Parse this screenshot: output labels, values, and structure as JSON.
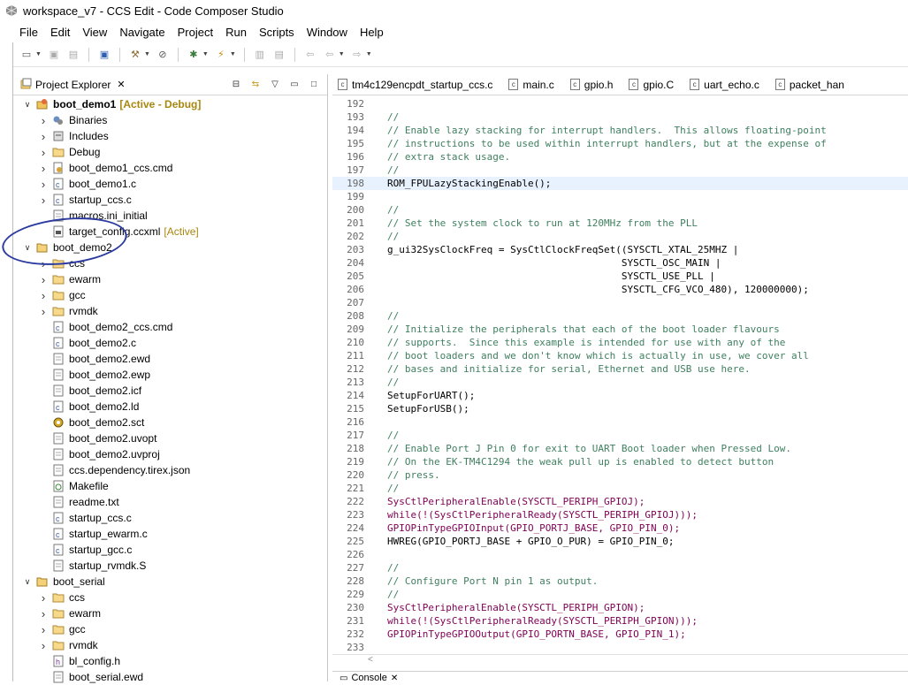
{
  "window": {
    "title": "workspace_v7 - CCS Edit - Code Composer Studio"
  },
  "menu": [
    "File",
    "Edit",
    "View",
    "Navigate",
    "Project",
    "Run",
    "Scripts",
    "Window",
    "Help"
  ],
  "toolbar_icons": [
    "new-icon",
    "save-icon",
    "save-all-icon",
    "terminal-icon",
    "build-icon",
    "clear-icon",
    "debug-icon",
    "flash-icon",
    "nav-icon",
    "nav2-icon",
    "back-icon",
    "forward-icon"
  ],
  "explorer": {
    "title": "Project Explorer",
    "tree": [
      {
        "label": "boot_demo1",
        "meta": "[Active - Debug]",
        "level": 0,
        "expanded": true,
        "icon": "project"
      },
      {
        "label": "Binaries",
        "level": 1,
        "expanded": false,
        "icon": "binaries"
      },
      {
        "label": "Includes",
        "level": 1,
        "expanded": false,
        "icon": "includes"
      },
      {
        "label": "Debug",
        "level": 1,
        "expanded": false,
        "icon": "folder"
      },
      {
        "label": "boot_demo1_ccs.cmd",
        "level": 1,
        "expanded": false,
        "icon": "cmd"
      },
      {
        "label": "boot_demo1.c",
        "level": 1,
        "expanded": false,
        "icon": "c"
      },
      {
        "label": "startup_ccs.c",
        "level": 1,
        "expanded": false,
        "icon": "c"
      },
      {
        "label": "macros.ini_initial",
        "level": 1,
        "icon": "file"
      },
      {
        "label": "target_config.ccxml",
        "meta": "[Active]",
        "level": 1,
        "icon": "ccxml"
      },
      {
        "label": "boot_demo2",
        "level": 0,
        "expanded": true,
        "icon": "project-open"
      },
      {
        "label": "ccs",
        "level": 1,
        "expanded": false,
        "icon": "folder"
      },
      {
        "label": "ewarm",
        "level": 1,
        "expanded": false,
        "icon": "folder"
      },
      {
        "label": "gcc",
        "level": 1,
        "expanded": false,
        "icon": "folder"
      },
      {
        "label": "rvmdk",
        "level": 1,
        "expanded": false,
        "icon": "folder"
      },
      {
        "label": "boot_demo2_ccs.cmd",
        "level": 1,
        "icon": "c"
      },
      {
        "label": "boot_demo2.c",
        "level": 1,
        "icon": "c"
      },
      {
        "label": "boot_demo2.ewd",
        "level": 1,
        "icon": "file"
      },
      {
        "label": "boot_demo2.ewp",
        "level": 1,
        "icon": "file"
      },
      {
        "label": "boot_demo2.icf",
        "level": 1,
        "icon": "file"
      },
      {
        "label": "boot_demo2.ld",
        "level": 1,
        "icon": "c"
      },
      {
        "label": "boot_demo2.sct",
        "level": 1,
        "icon": "gear"
      },
      {
        "label": "boot_demo2.uvopt",
        "level": 1,
        "icon": "file"
      },
      {
        "label": "boot_demo2.uvproj",
        "level": 1,
        "icon": "file"
      },
      {
        "label": "ccs.dependency.tirex.json",
        "level": 1,
        "icon": "file"
      },
      {
        "label": "Makefile",
        "level": 1,
        "icon": "make"
      },
      {
        "label": "readme.txt",
        "level": 1,
        "icon": "file"
      },
      {
        "label": "startup_ccs.c",
        "level": 1,
        "icon": "c"
      },
      {
        "label": "startup_ewarm.c",
        "level": 1,
        "icon": "c"
      },
      {
        "label": "startup_gcc.c",
        "level": 1,
        "icon": "c"
      },
      {
        "label": "startup_rvmdk.S",
        "level": 1,
        "icon": "file"
      },
      {
        "label": "boot_serial",
        "level": 0,
        "expanded": true,
        "icon": "project-open"
      },
      {
        "label": "ccs",
        "level": 1,
        "expanded": false,
        "icon": "folder"
      },
      {
        "label": "ewarm",
        "level": 1,
        "expanded": false,
        "icon": "folder"
      },
      {
        "label": "gcc",
        "level": 1,
        "expanded": false,
        "icon": "folder"
      },
      {
        "label": "rvmdk",
        "level": 1,
        "expanded": false,
        "icon": "folder"
      },
      {
        "label": "bl_config.h",
        "level": 1,
        "icon": "h"
      },
      {
        "label": "boot_serial.ewd",
        "level": 1,
        "icon": "file"
      }
    ]
  },
  "editor": {
    "tabs": [
      "tm4c129encpdt_startup_ccs.c",
      "main.c",
      "gpio.h",
      "gpio.C",
      "uart_echo.c",
      "packet_han"
    ],
    "lines": [
      {
        "n": "192",
        "t": "",
        "k": "plain"
      },
      {
        "n": "193",
        "t": "//",
        "k": "cm"
      },
      {
        "n": "194",
        "t": "// Enable lazy stacking for interrupt handlers.  This allows floating-point",
        "k": "cm"
      },
      {
        "n": "195",
        "t": "// instructions to be used within interrupt handlers, but at the expense of",
        "k": "cm"
      },
      {
        "n": "196",
        "t": "// extra stack usage.",
        "k": "cm"
      },
      {
        "n": "197",
        "t": "//",
        "k": "cm"
      },
      {
        "n": "198",
        "t": "ROM_FPULazyStackingEnable();",
        "k": "plain",
        "hl": true
      },
      {
        "n": "199",
        "t": "",
        "k": "plain"
      },
      {
        "n": "200",
        "t": "//",
        "k": "cm"
      },
      {
        "n": "201",
        "t": "// Set the system clock to run at 120MHz from the PLL",
        "k": "cm"
      },
      {
        "n": "202",
        "t": "//",
        "k": "cm"
      },
      {
        "n": "203",
        "t": "g_ui32SysClockFreq = SysCtlClockFreqSet((SYSCTL_XTAL_25MHZ |",
        "k": "plain"
      },
      {
        "n": "204",
        "t": "                                        SYSCTL_OSC_MAIN |",
        "k": "plain"
      },
      {
        "n": "205",
        "t": "                                        SYSCTL_USE_PLL |",
        "k": "plain"
      },
      {
        "n": "206",
        "t": "                                        SYSCTL_CFG_VCO_480), 120000000);",
        "k": "plain"
      },
      {
        "n": "207",
        "t": "",
        "k": "plain"
      },
      {
        "n": "208",
        "t": "//",
        "k": "cm"
      },
      {
        "n": "209",
        "t": "// Initialize the peripherals that each of the boot loader flavours",
        "k": "cm"
      },
      {
        "n": "210",
        "t": "// supports.  Since this example is intended for use with any of the",
        "k": "cm"
      },
      {
        "n": "211",
        "t": "// boot loaders and we don't know which is actually in use, we cover all",
        "k": "cm"
      },
      {
        "n": "212",
        "t": "// bases and initialize for serial, Ethernet and USB use here.",
        "k": "cm"
      },
      {
        "n": "213",
        "t": "//",
        "k": "cm"
      },
      {
        "n": "214",
        "t": "SetupForUART();",
        "k": "plain"
      },
      {
        "n": "215",
        "t": "SetupForUSB();",
        "k": "plain"
      },
      {
        "n": "216",
        "t": "",
        "k": "plain"
      },
      {
        "n": "217",
        "t": "//",
        "k": "cm"
      },
      {
        "n": "218",
        "t": "// Enable Port J Pin 0 for exit to UART Boot loader when Pressed Low.",
        "k": "cm"
      },
      {
        "n": "219",
        "t": "// On the EK-TM4C1294 the weak pull up is enabled to detect button",
        "k": "cm"
      },
      {
        "n": "220",
        "t": "// press.",
        "k": "cm"
      },
      {
        "n": "221",
        "t": "//",
        "k": "cm"
      },
      {
        "n": "222",
        "t": "SysCtlPeripheralEnable(SYSCTL_PERIPH_GPIOJ);",
        "k": "fn"
      },
      {
        "n": "223",
        "t": "while(!(SysCtlPeripheralReady(SYSCTL_PERIPH_GPIOJ)));",
        "k": "fn"
      },
      {
        "n": "224",
        "t": "GPIOPinTypeGPIOInput(GPIO_PORTJ_BASE, GPIO_PIN_0);",
        "k": "fn"
      },
      {
        "n": "225",
        "t": "HWREG(GPIO_PORTJ_BASE + GPIO_O_PUR) = GPIO_PIN_0;",
        "k": "plain"
      },
      {
        "n": "226",
        "t": "",
        "k": "plain"
      },
      {
        "n": "227",
        "t": "//",
        "k": "cm"
      },
      {
        "n": "228",
        "t": "// Configure Port N pin 1 as output.",
        "k": "cm"
      },
      {
        "n": "229",
        "t": "//",
        "k": "cm"
      },
      {
        "n": "230",
        "t": "SysCtlPeripheralEnable(SYSCTL_PERIPH_GPION);",
        "k": "fn"
      },
      {
        "n": "231",
        "t": "while(!(SysCtlPeripheralReady(SYSCTL_PERIPH_GPION)));",
        "k": "fn"
      },
      {
        "n": "232",
        "t": "GPIOPinTypeGPIOOutput(GPIO_PORTN_BASE, GPIO_PIN_1);",
        "k": "fn"
      },
      {
        "n": "233",
        "t": "",
        "k": "plain"
      }
    ]
  },
  "console": {
    "label": "Console"
  },
  "colors": {
    "comment": "#3f7f5f",
    "keyword": "#7f0055",
    "active_meta": "#a8870e",
    "annotation": "#2b3ba0"
  }
}
